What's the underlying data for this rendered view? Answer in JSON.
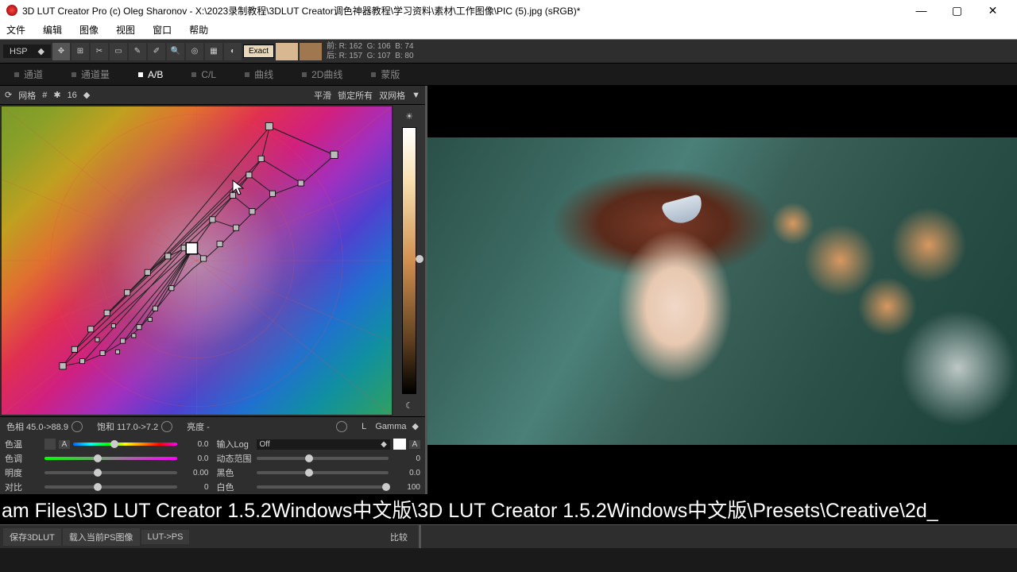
{
  "title": "3D LUT Creator Pro (c) Oleg Sharonov - X:\\2023录制教程\\3DLUT Creator调色神器教程\\学习资料\\素材\\工作图像\\PIC (5).jpg (sRGB)*",
  "menu": [
    "文件",
    "编辑",
    "图像",
    "视图",
    "窗口",
    "帮助"
  ],
  "colorspace": "HSP",
  "exact": "Exact",
  "rgb_before": {
    "label": "前:",
    "R": "R: 162",
    "G": "G: 106",
    "B": "B:  74"
  },
  "rgb_after": {
    "label": "后:",
    "R": "R: 157",
    "G": "G: 107",
    "B": "B:  80"
  },
  "tabs": [
    {
      "label": "通道",
      "active": false
    },
    {
      "label": "通道量",
      "active": false
    },
    {
      "label": "A/B",
      "active": true
    },
    {
      "label": "C/L",
      "active": false
    },
    {
      "label": "曲线",
      "active": false
    },
    {
      "label": "2D曲线",
      "active": false
    },
    {
      "label": "蒙版",
      "active": false
    }
  ],
  "gridbar": {
    "grid": "网格",
    "size": "16",
    "smooth": "平滑",
    "lockall": "锁定所有",
    "dualgrid": "双网格"
  },
  "readout": {
    "hue": "色相 45.0->88.9",
    "sat": "饱和 117.0->7.2",
    "lum": "亮度 -",
    "gamma_l": "L",
    "gamma": "Gamma"
  },
  "sliders_left": [
    {
      "lbl": "色温",
      "val": "0.0",
      "pos": 40,
      "rainbow": true,
      "pick": true
    },
    {
      "lbl": "色调",
      "val": "0.0",
      "pos": 40,
      "greenmag": true
    },
    {
      "lbl": "明度",
      "val": "0.00",
      "pos": 40
    },
    {
      "lbl": "对比",
      "val": "0",
      "pos": 40
    }
  ],
  "sliders_right": [
    {
      "lbl": "输入Log",
      "dd": "Off",
      "sw": true,
      "a": true
    },
    {
      "lbl": "动态范围",
      "val": "0",
      "pos": 40
    },
    {
      "lbl": "黑色",
      "val": "0.0",
      "pos": 40
    },
    {
      "lbl": "白色",
      "val": "100",
      "pos": 98
    }
  ],
  "pathbar": "am Files\\3D LUT Creator 1.5.2Windows中文版\\3D LUT Creator 1.5.2Windows中文版\\Presets\\Creative\\2d_",
  "bottom": {
    "save": "保存3DLUT",
    "load": "载入当前PS图像",
    "lutps": "LUT->PS",
    "compare": "比较"
  }
}
